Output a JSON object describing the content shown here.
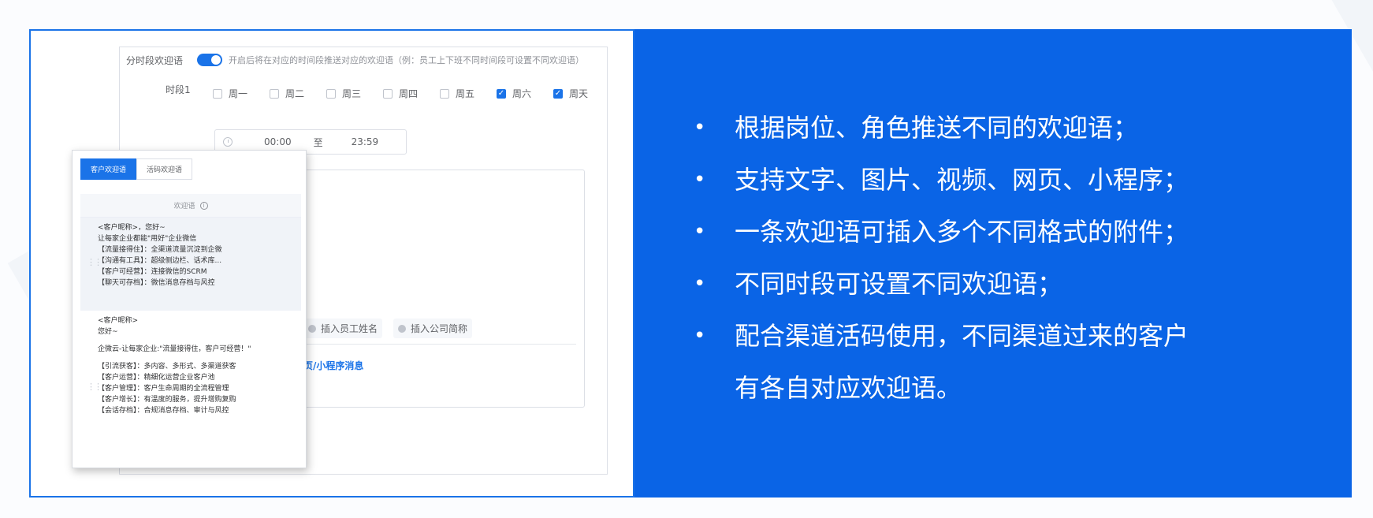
{
  "form": {
    "time_split_label": "分时段欢迎语",
    "time_split_hint": "开启后将在对应的时间段推送对应的欢迎语（例：员工上下班不同时间段可设置不同欢迎语）",
    "slot_label": "时段1",
    "days": [
      {
        "label": "周一",
        "checked": false
      },
      {
        "label": "周二",
        "checked": false
      },
      {
        "label": "周三",
        "checked": false
      },
      {
        "label": "周四",
        "checked": false
      },
      {
        "label": "周五",
        "checked": false
      },
      {
        "label": "周六",
        "checked": true
      },
      {
        "label": "周天",
        "checked": true
      }
    ],
    "time_start": "00:00",
    "time_to": "至",
    "time_end": "23:59",
    "insert_staff_name": "插入员工姓名",
    "insert_company_short": "插入公司简称",
    "miniapp_link": "页/小程序消息"
  },
  "overlay": {
    "tabs": [
      "客户欢迎语",
      "活码欢迎语"
    ],
    "header": "欢迎语",
    "message1": [
      "<客户昵称>，您好~",
      "让每家企业都能\"用好\"企业微信",
      "【流量接得住】：全渠道流量沉淀到企微",
      "【沟通有工具】：超级侧边栏、话术库...",
      "【客户可经营】：连接微信的SCRM",
      "【聊天可存档】：微信消息存档与风控"
    ],
    "message2_head": [
      "<客户昵称>",
      "您好~"
    ],
    "message2_intro": "企微云-让每家企业:\"流量接得住，客户可经营！\"",
    "message2_lines": [
      "【引流获客】：多内容、多形式、多渠道获客",
      "【客户运营】：精细化运营企业客户池",
      "【客户管理】：客户生命周期的全流程管理",
      "【客户增长】：有温度的服务，提升增购复购",
      "【会话存档】：合规消息存档、审计与风控"
    ]
  },
  "features": [
    "根据岗位、角色推送不同的欢迎语；",
    "支持文字、图片、视频、网页、小程序；",
    "一条欢迎语可插入多个不同格式的附件；",
    "不同时段可设置不同欢迎语；",
    "配合渠道活码使用，不同渠道过来的客户\n有各自对应欢迎语。"
  ],
  "colors": {
    "accent": "#1a73e8",
    "panel_blue": "#0a64e6"
  }
}
